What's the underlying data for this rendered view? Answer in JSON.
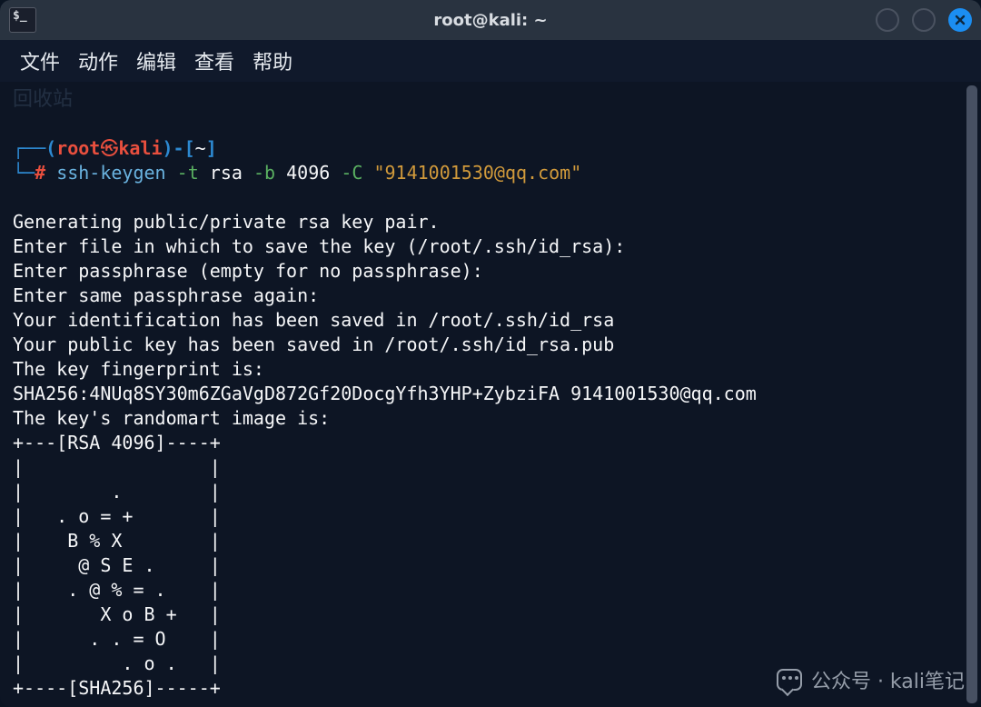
{
  "titlebar": {
    "icon_text": "$_",
    "title": "root@kali: ~"
  },
  "menubar": {
    "items": [
      "文件",
      "动作",
      "编辑",
      "查看",
      "帮助"
    ]
  },
  "desktop_ghost": "回收站",
  "prompt": {
    "lparen": "┌──(",
    "user": "root",
    "sep_glyph": "㉿",
    "host": "kali",
    "rparen": ")-[",
    "cwd": "~",
    "rbrack": "]",
    "line2_prefix": "└─",
    "hash": "#",
    "cmd_bin": "ssh-keygen",
    "flag_t": "-t",
    "arg_t": "rsa",
    "flag_b": "-b",
    "arg_b": "4096",
    "flag_c": "-C",
    "arg_email": "\"9141001530@qq.com\""
  },
  "output": {
    "lines": [
      "Generating public/private rsa key pair.",
      "Enter file in which to save the key (/root/.ssh/id_rsa):",
      "Enter passphrase (empty for no passphrase):",
      "Enter same passphrase again:",
      "Your identification has been saved in /root/.ssh/id_rsa",
      "Your public key has been saved in /root/.ssh/id_rsa.pub",
      "The key fingerprint is:",
      "SHA256:4NUq8SY30m6ZGaVgD872Gf20DocgYfh3YHP+ZybziFA 9141001530@qq.com",
      "The key's randomart image is:",
      "+---[RSA 4096]----+",
      "|                 |",
      "|        .        |",
      "|   . o = +       |",
      "|    B % X        |",
      "|     @ S E .     |",
      "|    . @ % = .    |",
      "|       X o B +   |",
      "|      . . = O    |",
      "|         . o .   |",
      "+----[SHA256]-----+"
    ]
  },
  "watermark": {
    "text": "公众号 · kali笔记"
  }
}
